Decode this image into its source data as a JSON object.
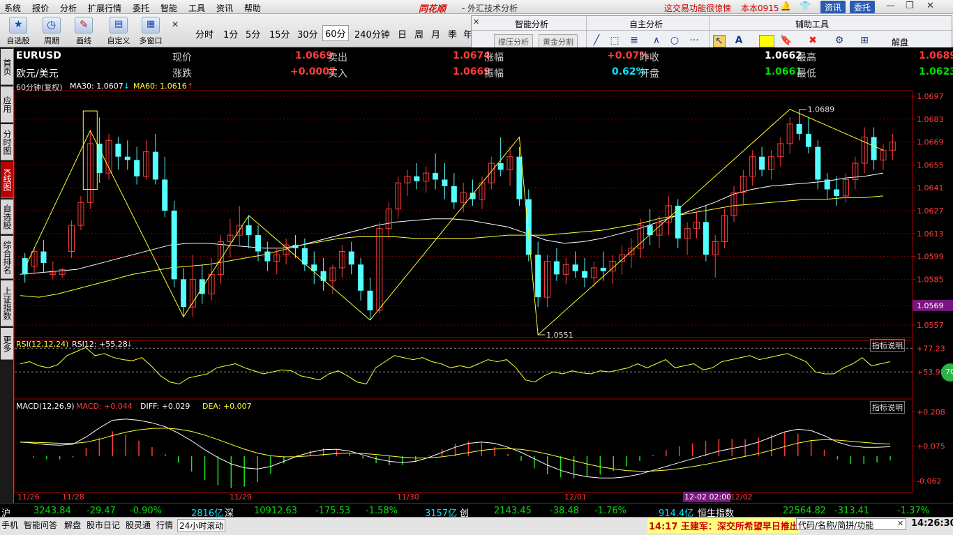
{
  "menu": {
    "items": [
      "系统",
      "报价",
      "分析",
      "扩展行情",
      "委托",
      "智能",
      "工具",
      "资讯",
      "帮助"
    ],
    "brand": "同花顺",
    "title": "- 外汇技术分析",
    "notice": "这交易功能很惊悚",
    "version": "本本0915",
    "btn_info": "资讯",
    "btn_trade": "委托"
  },
  "toolbar": {
    "buttons": [
      "自选股",
      "周期",
      "画线",
      "自定义",
      "多窗口"
    ],
    "periods": [
      "分时",
      "1分",
      "5分",
      "15分",
      "30分",
      "60分",
      "240分钟",
      "日",
      "周",
      "月",
      "季",
      "年"
    ],
    "active_period": "60分"
  },
  "panel": {
    "smart_title": "智能分析",
    "self_title": "自主分析",
    "aux_title": "辅助工具",
    "btn_pressure": "撑压分析",
    "btn_golden": "黄金分割",
    "explain": "解盘"
  },
  "sidebar": {
    "tabs": [
      "首页",
      "应用",
      "分时图",
      "K线图",
      "自选股",
      "综合排名",
      "上证指数",
      "更多"
    ],
    "active": "K线图"
  },
  "quote": {
    "symbol": "EURUSD",
    "name": "欧元/美元",
    "label_price": "现价",
    "price": "1.0669",
    "label_sell": "卖出",
    "sell": "1.0674",
    "label_rise": "涨幅",
    "rise_pct": "+0.07%",
    "label_prev": "昨收",
    "prev": "1.0662",
    "label_high": "最高",
    "high": "1.0689",
    "label_change": "涨跌",
    "change": "+0.0007",
    "label_buy": "买入",
    "buy": "1.0669",
    "label_amp": "振幅",
    "amp": "0.62%",
    "label_open": "开盘",
    "open": "1.0661",
    "label_low": "最低",
    "low": "1.0623"
  },
  "chart_data": {
    "type": "candlestick",
    "period_label": "60分钟(复权)",
    "ma30_label": "MA30: 1.0607",
    "ma60_label": "MA60: 1.0616",
    "y_ticks": [
      "1.0697",
      "1.0683",
      "1.0669",
      "1.0655",
      "1.0641",
      "1.0627",
      "1.0613",
      "1.0599",
      "1.0585",
      "1.0569",
      "1.0557"
    ],
    "y_tick_values": [
      1.0697,
      1.0683,
      1.0669,
      1.0655,
      1.0641,
      1.0627,
      1.0613,
      1.0599,
      1.0585,
      1.0569,
      1.0557
    ],
    "current_price_tag": "1.0569",
    "ylim": [
      1.0551,
      1.0697
    ],
    "annotations": [
      {
        "text": "1.0689",
        "value": 1.0689
      },
      {
        "text": "1.0551",
        "value": 1.0551
      }
    ],
    "x_labels": [
      "11/26",
      "11/28",
      "11/29",
      "11/30",
      "12/01",
      "12/02"
    ],
    "crosshair_time": "12-02 02:00",
    "candles": [
      [
        1.0598,
        1.0601,
        1.0583,
        1.0588
      ],
      [
        1.0593,
        1.0604,
        1.0588,
        1.0602
      ],
      [
        1.0602,
        1.0609,
        1.0589,
        1.0595
      ],
      [
        1.0588,
        1.0596,
        1.0585,
        1.0589
      ],
      [
        1.0588,
        1.0592,
        1.0586,
        1.0591
      ],
      [
        1.0602,
        1.0621,
        1.0598,
        1.0618
      ],
      [
        1.0618,
        1.0636,
        1.0615,
        1.0632
      ],
      [
        1.0632,
        1.0676,
        1.0628,
        1.0668
      ],
      [
        1.0668,
        1.0684,
        1.0644,
        1.065
      ],
      [
        1.065,
        1.0674,
        1.0646,
        1.067
      ],
      [
        1.0668,
        1.0672,
        1.0652,
        1.066
      ],
      [
        1.066,
        1.067,
        1.0652,
        1.0658
      ],
      [
        1.0658,
        1.0666,
        1.0643,
        1.0648
      ],
      [
        1.0648,
        1.067,
        1.0646,
        1.0663
      ],
      [
        1.0663,
        1.0674,
        1.0643,
        1.0646
      ],
      [
        1.0646,
        1.066,
        1.0623,
        1.0627
      ],
      [
        1.0627,
        1.0633,
        1.058,
        1.0585
      ],
      [
        1.0585,
        1.0592,
        1.0562,
        1.0568
      ],
      [
        1.0568,
        1.06,
        1.0562,
        1.0585
      ],
      [
        1.0585,
        1.0594,
        1.057,
        1.0576
      ],
      [
        1.0576,
        1.0598,
        1.0572,
        1.0588
      ],
      [
        1.0588,
        1.0612,
        1.0582,
        1.0608
      ],
      [
        1.0608,
        1.0622,
        1.0598,
        1.0612
      ],
      [
        1.0612,
        1.063,
        1.0606,
        1.0618
      ],
      [
        1.0618,
        1.0624,
        1.0604,
        1.0612
      ],
      [
        1.0612,
        1.0618,
        1.0596,
        1.0602
      ],
      [
        1.0602,
        1.0608,
        1.059,
        1.0596
      ],
      [
        1.0596,
        1.0604,
        1.0588,
        1.06
      ],
      [
        1.06,
        1.061,
        1.0594,
        1.0606
      ],
      [
        1.0606,
        1.0612,
        1.0598,
        1.0604
      ],
      [
        1.0604,
        1.061,
        1.059,
        1.0594
      ],
      [
        1.0594,
        1.0602,
        1.0582,
        1.059
      ],
      [
        1.059,
        1.0598,
        1.0578,
        1.0584
      ],
      [
        1.0584,
        1.0594,
        1.0576,
        1.0592
      ],
      [
        1.0592,
        1.0606,
        1.0586,
        1.0602
      ],
      [
        1.0602,
        1.0608,
        1.0588,
        1.0594
      ],
      [
        1.0594,
        1.0598,
        1.0572,
        1.0578
      ],
      [
        1.0578,
        1.0586,
        1.056,
        1.0566
      ],
      [
        1.0566,
        1.062,
        1.0564,
        1.0616
      ],
      [
        1.0616,
        1.0632,
        1.061,
        1.0628
      ],
      [
        1.0628,
        1.0648,
        1.0622,
        1.0644
      ],
      [
        1.0644,
        1.0652,
        1.0636,
        1.0648
      ],
      [
        1.0648,
        1.0656,
        1.064,
        1.0645
      ],
      [
        1.0645,
        1.0654,
        1.0638,
        1.065
      ],
      [
        1.065,
        1.0662,
        1.064,
        1.0646
      ],
      [
        1.0646,
        1.0656,
        1.0634,
        1.0642
      ],
      [
        1.0642,
        1.065,
        1.0628,
        1.0632
      ],
      [
        1.0632,
        1.0644,
        1.0626,
        1.0638
      ],
      [
        1.0638,
        1.0646,
        1.063,
        1.0634
      ],
      [
        1.0634,
        1.0648,
        1.0628,
        1.0644
      ],
      [
        1.0644,
        1.066,
        1.064,
        1.0656
      ],
      [
        1.0656,
        1.0672,
        1.0648,
        1.0652
      ],
      [
        1.0652,
        1.0666,
        1.0642,
        1.066
      ],
      [
        1.066,
        1.0666,
        1.063,
        1.0634
      ],
      [
        1.0634,
        1.064,
        1.0596,
        1.06
      ],
      [
        1.06,
        1.0608,
        1.0568,
        1.0574
      ],
      [
        1.0574,
        1.06,
        1.0568,
        1.0596
      ],
      [
        1.0596,
        1.0604,
        1.0584,
        1.0588
      ],
      [
        1.0588,
        1.0598,
        1.0582,
        1.0594
      ],
      [
        1.0594,
        1.0602,
        1.0586,
        1.059
      ],
      [
        1.059,
        1.0598,
        1.058,
        1.0586
      ],
      [
        1.0586,
        1.0596,
        1.058,
        1.0592
      ],
      [
        1.0592,
        1.0602,
        1.0584,
        1.059
      ],
      [
        1.059,
        1.06,
        1.0582,
        1.0596
      ],
      [
        1.0596,
        1.0606,
        1.0588,
        1.06
      ],
      [
        1.06,
        1.061,
        1.0592,
        1.0604
      ],
      [
        1.0604,
        1.0622,
        1.0598,
        1.0618
      ],
      [
        1.0618,
        1.0628,
        1.0606,
        1.0612
      ],
      [
        1.0612,
        1.0624,
        1.0604,
        1.062
      ],
      [
        1.062,
        1.0636,
        1.0612,
        1.063
      ],
      [
        1.063,
        1.0634,
        1.0604,
        1.061
      ],
      [
        1.061,
        1.062,
        1.06,
        1.0616
      ],
      [
        1.0616,
        1.0626,
        1.061,
        1.062
      ],
      [
        1.062,
        1.063,
        1.0596,
        1.06
      ],
      [
        1.06,
        1.0612,
        1.0586,
        1.0608
      ],
      [
        1.0608,
        1.0628,
        1.0604,
        1.0624
      ],
      [
        1.0624,
        1.0642,
        1.062,
        1.0638
      ],
      [
        1.0638,
        1.0652,
        1.063,
        1.0648
      ],
      [
        1.0648,
        1.0664,
        1.0642,
        1.066
      ],
      [
        1.066,
        1.0666,
        1.0648,
        1.0652
      ],
      [
        1.0652,
        1.0664,
        1.0646,
        1.066
      ],
      [
        1.066,
        1.0672,
        1.0654,
        1.0668
      ],
      [
        1.0668,
        1.0684,
        1.0662,
        1.068
      ],
      [
        1.068,
        1.0689,
        1.067,
        1.0674
      ],
      [
        1.0674,
        1.0684,
        1.0662,
        1.0666
      ],
      [
        1.0666,
        1.067,
        1.064,
        1.0646
      ],
      [
        1.0646,
        1.065,
        1.0634,
        1.064
      ],
      [
        1.064,
        1.0648,
        1.063,
        1.0636
      ],
      [
        1.0636,
        1.065,
        1.0632,
        1.0646
      ],
      [
        1.0646,
        1.066,
        1.064,
        1.0656
      ],
      [
        1.0656,
        1.0678,
        1.065,
        1.0672
      ],
      [
        1.0672,
        1.0678,
        1.0652,
        1.0658
      ],
      [
        1.0658,
        1.0668,
        1.0652,
        1.0664
      ],
      [
        1.0664,
        1.0674,
        1.0658,
        1.0669
      ]
    ],
    "ma30": [
      1.0588,
      1.0589,
      1.059,
      1.0591,
      1.0594,
      1.0597,
      1.06,
      1.0603,
      1.0606,
      1.0607,
      1.0607,
      1.0606,
      1.0605,
      1.0604,
      1.0604,
      1.0606,
      1.0609,
      1.0612,
      1.0615,
      1.0618,
      1.062,
      1.0621,
      1.0622,
      1.0622,
      1.0621,
      1.0619,
      1.0617,
      1.0613,
      1.0609,
      1.0607,
      1.0608,
      1.061,
      1.0613,
      1.0616,
      1.062,
      1.0624,
      1.0628,
      1.0632,
      1.0637,
      1.064,
      1.0642,
      1.0643,
      1.0644,
      1.0645,
      1.0647,
      1.0648,
      1.065
    ],
    "ma60": [
      1.0575,
      1.0574,
      1.0576,
      1.0579,
      1.0582,
      1.0585,
      1.0588,
      1.059,
      1.0592,
      1.0593,
      1.0594,
      1.0596,
      1.0598,
      1.06,
      1.0603,
      1.0606,
      1.0608,
      1.061,
      1.0611,
      1.0611,
      1.0611,
      1.061,
      1.061,
      1.061,
      1.061,
      1.0611,
      1.0612,
      1.0612,
      1.0612,
      1.0613,
      1.0614,
      1.0615,
      1.0617,
      1.0619,
      1.0622,
      1.0624,
      1.0626,
      1.0628,
      1.063,
      1.0631,
      1.0632,
      1.0633,
      1.0634,
      1.0634,
      1.0635,
      1.0635,
      1.0636
    ],
    "zigzag": [
      [
        0,
        1.0592
      ],
      [
        7,
        1.0676
      ],
      [
        17,
        1.0562
      ],
      [
        24,
        1.0624
      ],
      [
        37,
        1.056
      ],
      [
        53,
        1.0672
      ],
      [
        55,
        1.0551
      ],
      [
        82,
        1.0689
      ],
      [
        92,
        1.0664
      ]
    ],
    "rsi": {
      "label": "RSI(12,12,24)",
      "value_label": "RSI12: +55.28",
      "ticks": [
        "+77.23",
        "+53.95"
      ],
      "values": [
        62,
        64,
        60,
        58,
        61,
        70,
        74,
        78,
        70,
        72,
        68,
        66,
        65,
        68,
        60,
        50,
        44,
        42,
        48,
        50,
        52,
        58,
        60,
        62,
        58,
        55,
        52,
        54,
        56,
        55,
        50,
        48,
        46,
        52,
        55,
        50,
        44,
        42,
        58,
        64,
        70,
        68,
        66,
        68,
        64,
        62,
        58,
        60,
        58,
        62,
        66,
        64,
        66,
        58,
        46,
        44,
        50,
        54,
        52,
        55,
        53,
        52,
        55,
        54,
        56,
        58,
        62,
        58,
        62,
        66,
        58,
        60,
        62,
        56,
        58,
        64,
        66,
        68,
        70,
        66,
        68,
        70,
        72,
        68,
        64,
        54,
        52,
        52,
        58,
        62,
        68,
        60,
        62,
        64
      ]
    },
    "macd": {
      "label": "MACD(12,26,9)",
      "macd_label": "MACD: +0.044",
      "diff_label": "DIFF: +0.029",
      "dea_label": "DEA: +0.007",
      "ticks": [
        "+0.208",
        "+0.075",
        "-0.062"
      ],
      "diff": [
        0.09,
        0.086,
        0.08,
        0.078,
        0.082,
        0.11,
        0.145,
        0.175,
        0.18,
        0.175,
        0.165,
        0.15,
        0.125,
        0.095,
        0.06,
        0.03,
        0.005,
        -0.01,
        -0.015,
        -0.005,
        0.015,
        0.035,
        0.05,
        0.06,
        0.062,
        0.055,
        0.04,
        0.025,
        0.015,
        0.01,
        0.015,
        0.03,
        0.05,
        0.07,
        0.085,
        0.09,
        0.085,
        0.07,
        0.05,
        0.025,
        0.0,
        -0.02,
        -0.035,
        -0.045,
        -0.05,
        -0.05,
        -0.045,
        -0.035,
        -0.02,
        -0.005,
        0.01,
        0.025,
        0.04,
        0.055,
        0.065,
        0.075,
        0.09,
        0.11,
        0.13,
        0.14,
        0.135,
        0.115,
        0.09,
        0.075,
        0.07,
        0.07,
        0.072
      ]
    }
  },
  "status": {
    "sh_label": "沪",
    "sh": "3243.84",
    "sh_chg": "-29.47",
    "sh_pct": "-0.90%",
    "sh_vol": "2816亿",
    "sz_label": "深",
    "sz": "10912.63",
    "sz_chg": "-175.53",
    "sz_pct": "-1.58%",
    "sz_vol": "3157亿",
    "cy_label": "创",
    "cy": "2143.45",
    "cy_chg": "-38.48",
    "cy_pct": "-1.76%",
    "cy_vol": "914.4亿",
    "hs_label": "恒生指数",
    "hs": "22564.82",
    "hs_chg": "-313.41",
    "hs_pct": "-1.37%"
  },
  "bottom": {
    "items": [
      "手机",
      "智能问答",
      "解盘",
      "股市日记",
      "股灵通",
      "行情",
      "24小时滚动"
    ],
    "news": "14:17 王建军：深交所希望早日推出",
    "code_placeholder": "代码/名称/简拼/功能",
    "clock": "14:26:30"
  },
  "colors": {
    "up": "#ff3c3c",
    "down": "#54ffff",
    "ma30": "#ffffff",
    "ma60": "#ffff30",
    "grid": "#7a0000"
  }
}
